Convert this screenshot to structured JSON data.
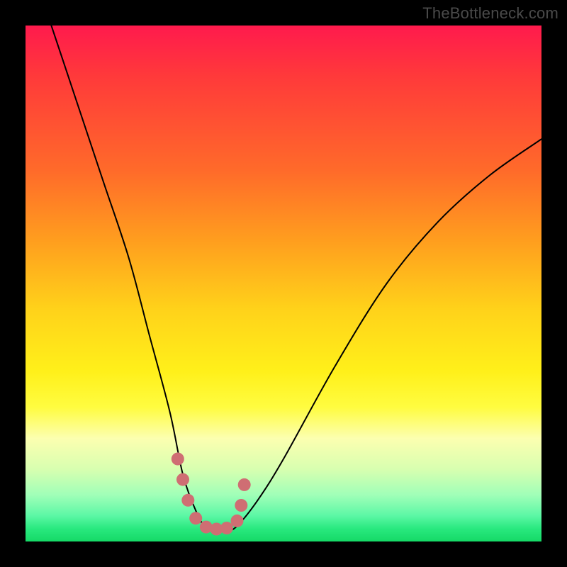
{
  "watermark": "TheBottleneck.com",
  "colors": {
    "page_bg": "#000000",
    "gradient_top": "#ff1a4d",
    "gradient_bottom": "#15d966",
    "curve_stroke": "#000000",
    "marker_fill": "#cf6e73"
  },
  "chart_data": {
    "type": "line",
    "title": "",
    "xlabel": "",
    "ylabel": "",
    "xlim": [
      0,
      100
    ],
    "ylim": [
      0,
      100
    ],
    "grid": false,
    "legend": false,
    "note": "Axes unlabeled in source; x/y in percent of plot area, y=0 at bottom.",
    "series": [
      {
        "name": "bottleneck-curve",
        "x": [
          5,
          10,
          15,
          20,
          24,
          28,
          30.5,
          33,
          35,
          37,
          39,
          41,
          45,
          50,
          60,
          70,
          80,
          90,
          100
        ],
        "y": [
          100,
          85,
          70,
          55,
          40,
          25,
          13,
          6,
          2.5,
          2,
          2,
          3,
          8,
          16,
          34,
          50,
          62,
          71,
          78
        ]
      }
    ],
    "markers": {
      "name": "highlight-dots",
      "color": "#cf6e73",
      "x": [
        29.5,
        30.5,
        31.5,
        33,
        35,
        37,
        39,
        41,
        41.8,
        42.4
      ],
      "y": [
        16,
        12,
        8,
        4.5,
        2.8,
        2.4,
        2.6,
        4,
        7,
        11
      ]
    }
  }
}
